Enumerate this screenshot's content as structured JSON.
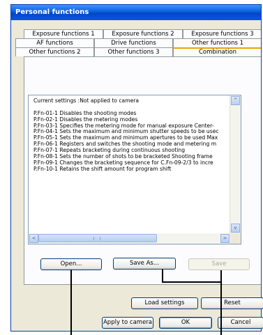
{
  "window": {
    "title": "Personal functions"
  },
  "tabs": {
    "row1": [
      "Exposure functions 1",
      "Exposure functions 2",
      "Exposure functions 3"
    ],
    "row2": [
      "AF functions",
      "Drive functions",
      "Other functions 1"
    ],
    "row3": [
      "Other functions 2",
      "Other functions 3",
      "Combination"
    ],
    "active": "Combination"
  },
  "list": {
    "header": "Current settings :Not applied to camera",
    "items": [
      "P.Fn-01-1  Disables the shooting modes",
      "P.Fn-02-1  Disables the metering modes",
      "P.Fn-03-1  Specifies the metering mode for manual exposure  Center-",
      "P.Fn-04-1  Sets the maximum and minimum shutter speeds to be usec",
      "P.Fn-05-1  Sets the maximum and minimum apertures to be used  Max",
      "P.Fn-06-1  Registers and switches the shooting mode and metering m",
      "P.Fn-07-1  Repeats bracketing during continuous shooting",
      "P.Fn-08-1  Sets the number of shots to be bracketed Shooting frame",
      "P.Fn-09-1  Changes the bracketing sequence for C.Fn-09-2/3 to incre",
      "P.Fn-10-1  Retains the shift amount for program shift"
    ],
    "scroll_up_glyph": "^",
    "scroll_down_glyph": "v",
    "scroll_left_glyph": "<",
    "scroll_right_glyph": ">"
  },
  "buttons": {
    "open": "Open...",
    "save_as": "Save As...",
    "save": "Save",
    "load_settings": "Load settings",
    "reset": "Reset",
    "apply_to_camera": "Apply to camera",
    "ok": "OK",
    "cancel": "Cancel"
  }
}
